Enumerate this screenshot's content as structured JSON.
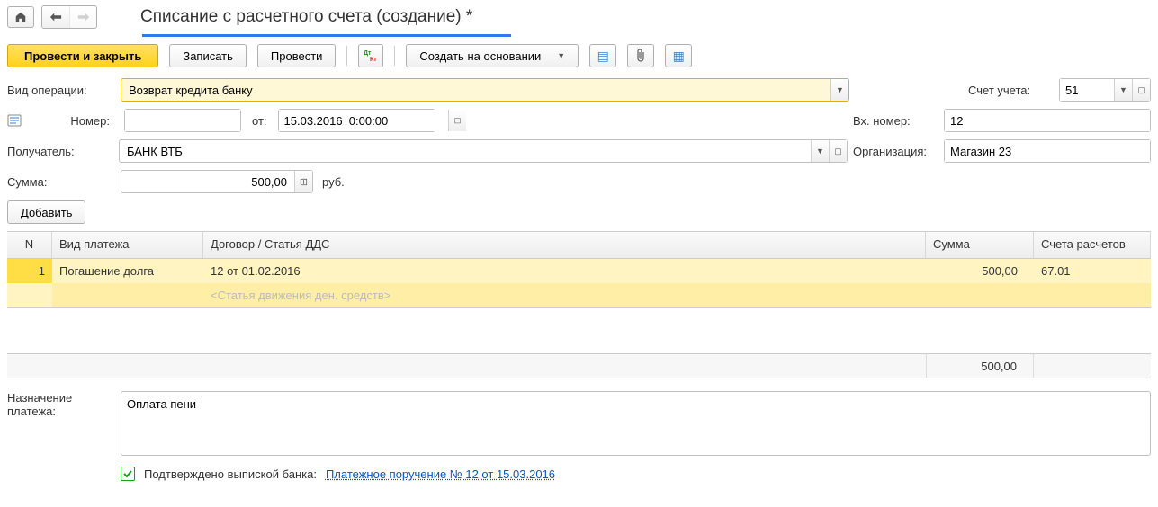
{
  "title": "Списание с расчетного счета (создание) *",
  "toolbar": {
    "post_close": "Провести и закрыть",
    "save": "Записать",
    "post": "Провести",
    "create_based": "Создать на основании"
  },
  "form": {
    "op_label": "Вид операции:",
    "op_value": "Возврат кредита банку",
    "num_label": "Номер:",
    "num_value": "",
    "date_label": "от:",
    "date_value": "15.03.2016  0:00:00",
    "recipient_label": "Получатель:",
    "recipient_value": "БАНК ВТБ",
    "sum_label": "Сумма:",
    "sum_value": "500,00",
    "sum_unit": "руб.",
    "account_label": "Счет учета:",
    "account_value": "51",
    "incoming_label": "Вх. номер:",
    "incoming_value": "12",
    "org_label": "Организация:",
    "org_value": "Магазин 23",
    "add_btn": "Добавить"
  },
  "table": {
    "headers": {
      "n": "N",
      "type": "Вид платежа",
      "contract": "Договор / Статья ДДС",
      "sum": "Сумма",
      "acc": "Счета расчетов"
    },
    "rows": [
      {
        "n": "1",
        "type": "Погашение долга",
        "contract": "12 от 01.02.2016",
        "dds_placeholder": "<Статья движения ден. средств>",
        "sum": "500,00",
        "acc": "67.01"
      }
    ],
    "total_sum": "500,00"
  },
  "purpose": {
    "label": "Назначение платежа:",
    "value": "Оплата пени"
  },
  "confirm": {
    "checked": true,
    "label": "Подтверждено выпиской банка:",
    "link": "Платежное поручение № 12 от 15.03.2016"
  }
}
